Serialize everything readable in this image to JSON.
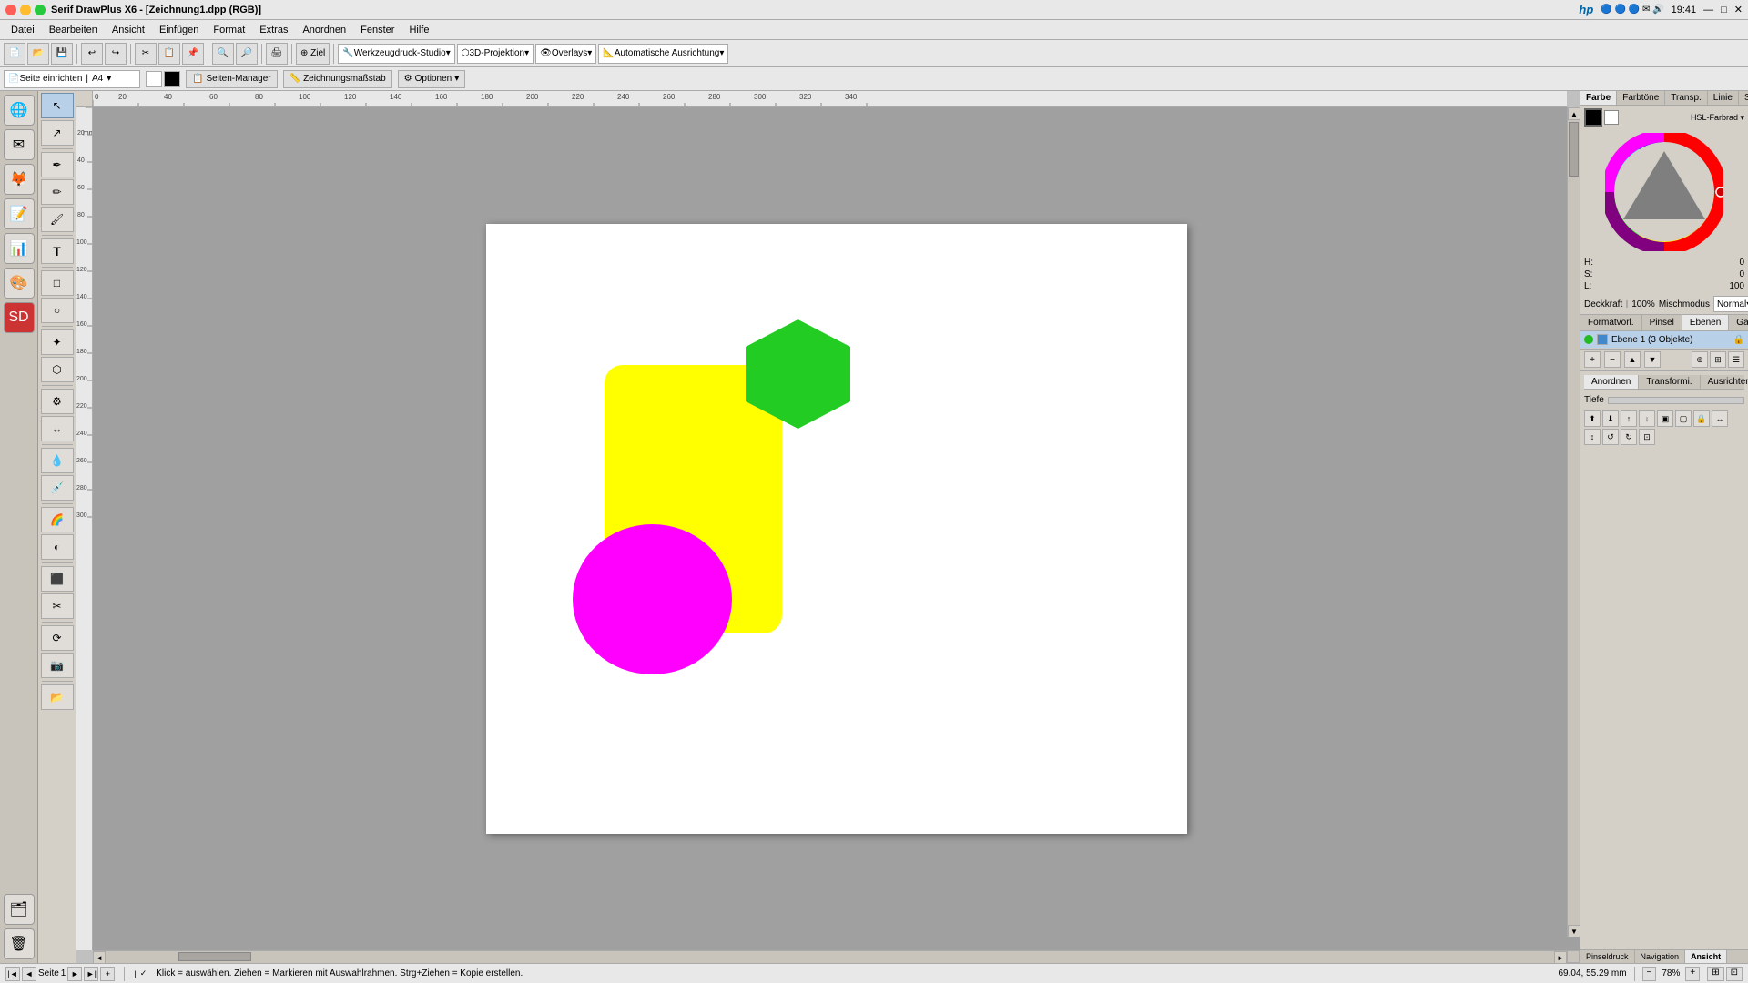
{
  "titlebar": {
    "title": "Serif DrawPlus X6 - [Zeichnung1.dpp (RGB)]",
    "time": "19:41",
    "dots": [
      "red",
      "yellow",
      "green"
    ]
  },
  "menubar": {
    "items": [
      "Datei",
      "Bearbeiten",
      "Ansicht",
      "Einfügen",
      "Format",
      "Extras",
      "Anordnen",
      "Fenster",
      "Hilfe"
    ]
  },
  "toolbar": {
    "buttons": [
      "↩",
      "↪",
      "✂",
      "📋",
      "🖨",
      "🔍",
      "🔎"
    ],
    "dropdowns": [
      "Werkzeugdruck-Studio",
      "3D-Projektion",
      "Overlays",
      "Automatische Ausrichtung"
    ]
  },
  "setupbar": {
    "page_setup_label": "Seite einrichten",
    "page_size": "A4",
    "manager_label": "Seiten-Manager",
    "scale_label": "Zeichnungsmaßstab",
    "options_label": "Optionen"
  },
  "left_tools": {
    "tools": [
      "↖",
      "↗",
      "✏",
      "✒",
      "🖊",
      "T",
      "□",
      "○",
      "⬡",
      "✦",
      "⚙",
      "🔗",
      "📐",
      "⬛",
      "🌈",
      "📷",
      "💧",
      "📂",
      "💾"
    ]
  },
  "canvas": {
    "shapes": {
      "yellow_rect": {
        "color": "#ffff00",
        "label": "Gelbes Rechteck"
      },
      "green_hex": {
        "color": "#22cc22",
        "label": "Grünes Hexagon"
      },
      "magenta_ellipse": {
        "color": "#ff00ff",
        "label": "Magenta Ellipse"
      }
    }
  },
  "color_panel": {
    "tabs": [
      "Farbe",
      "Farbtöne",
      "Transp.",
      "Linie",
      "Schab."
    ],
    "color_model": "HSL-Farbrad",
    "h_label": "H:",
    "h_val": "0",
    "s_label": "S:",
    "s_val": "0",
    "l_label": "L:",
    "l_val": "100",
    "opacity_label": "Deckkraft",
    "opacity_pct": "100%",
    "blend_label": "Mischmodus",
    "blend_mode": "Normal"
  },
  "layers_panel": {
    "tabs": [
      "Formatvorl.",
      "Pinsel",
      "Ebenen",
      "Galerie"
    ],
    "active_tab": "Ebenen",
    "layers": [
      {
        "name": "Ebene 1 (3 Objekte)",
        "visible": true,
        "locked": false
      }
    ]
  },
  "arrange_panel": {
    "tabs": [
      "Anordnen",
      "Transformi.",
      "Ausrichten"
    ],
    "active_tab": "Anordnen",
    "depth_label": "Tiefe"
  },
  "statusbar": {
    "page_label": "Seite",
    "page_num": "1",
    "hint": "Klick = auswählen. Ziehen = Markieren mit Auswahlrahmen. Strg+Ziehen = Kopie erstellen.",
    "coords": "69.04, 55.29 mm",
    "zoom": "78%",
    "bottom_tabs": [
      "Pinseldruck",
      "Navigation",
      "Ansicht"
    ]
  }
}
